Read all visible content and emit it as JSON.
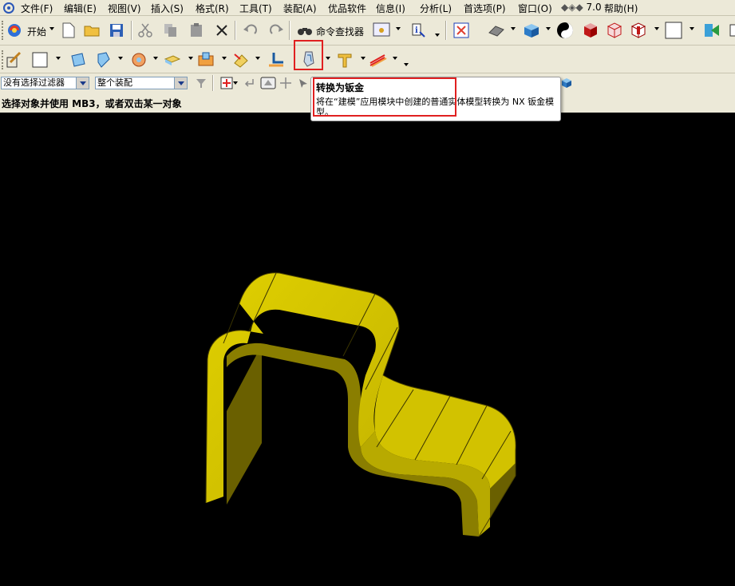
{
  "menu": {
    "items": [
      "文件(F)",
      "编辑(E)",
      "视图(V)",
      "插入(S)",
      "格式(R)",
      "工具(T)",
      "装配(A)",
      "优品软件",
      "信息(I)",
      "分析(L)",
      "首选项(P)",
      "窗口(O)",
      "7.0",
      "帮助(H)"
    ]
  },
  "toolbar1": {
    "start_label": "开始",
    "command_finder_label": "命令查找器"
  },
  "filterbar": {
    "selection_filter_value": "没有选择过滤器",
    "scope_value": "整个装配"
  },
  "status": {
    "prompt": "选择对象并使用 MB3，或者双击某一对象"
  },
  "tooltip": {
    "title": "转换为钣金",
    "description": "将在“建模”应用模块中创建的普通实体模型转换为 NX 钣金模型。"
  },
  "colors": {
    "toolbar_bg": "#ece9d8",
    "viewport_bg": "#000000",
    "part_face_light": "#d4c400",
    "part_face_dark": "#8a7e00",
    "highlight": "#e02020"
  },
  "icons": {
    "convert_to_sheet_metal": "convert-to-sheet-metal-icon"
  }
}
